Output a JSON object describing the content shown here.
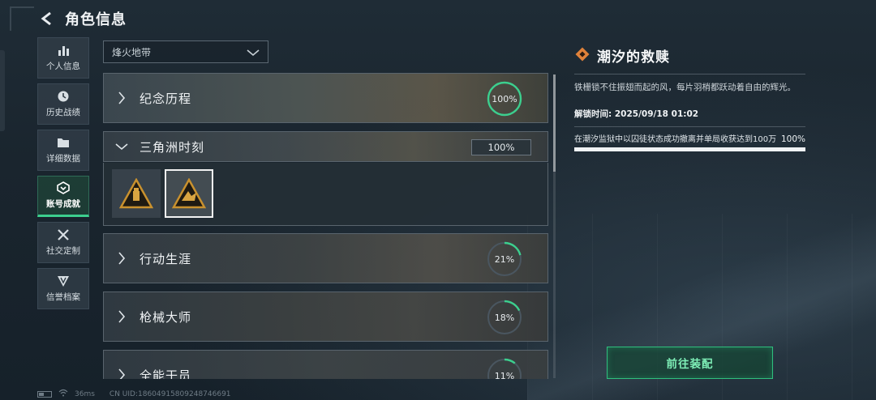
{
  "header": {
    "title": "角色信息",
    "back_icon": "back-arrow-icon"
  },
  "sidebar": {
    "items": [
      {
        "label": "个人信息",
        "icon": "bar-chart-icon",
        "active": false
      },
      {
        "label": "历史战绩",
        "icon": "clock-icon",
        "active": false
      },
      {
        "label": "详细数据",
        "icon": "folder-icon",
        "active": false
      },
      {
        "label": "账号成就",
        "icon": "achievement-icon",
        "active": true
      },
      {
        "label": "社交定制",
        "icon": "tools-icon",
        "active": false
      },
      {
        "label": "信誉档案",
        "icon": "shield-icon",
        "active": false
      }
    ]
  },
  "mode_select": {
    "value": "烽火地带"
  },
  "achievements": [
    {
      "name": "纪念历程",
      "progress": "100%",
      "progress_value": 1.0
    },
    {
      "name": "三角洲时刻",
      "progress": "100%",
      "progress_value": 1.0,
      "expanded": true
    },
    {
      "name": "行动生涯",
      "progress": "21%",
      "progress_value": 0.21
    },
    {
      "name": "枪械大师",
      "progress": "18%",
      "progress_value": 0.18
    },
    {
      "name": "全能干员",
      "progress": "11%",
      "progress_value": 0.11
    }
  ],
  "detail": {
    "title": "潮汐的救赎",
    "description": "铁栅锁不住振翅而起的风，每片羽梢都跃动着自由的辉光。",
    "unlock_label": "解锁时间:",
    "unlock_time": "2025/09/18 01:02",
    "task_text": "在潮汐监狱中以囚徒状态成功撤离并单局收获达到100万",
    "task_pct": "100%",
    "task_progress": 1.0
  },
  "equip_button": {
    "label": "前往装配"
  },
  "footer": {
    "ping": "36ms",
    "uid": "CN UID:18604915809248746691"
  },
  "colors": {
    "accent_green": "#3ccf8e",
    "ring_track": "#4a5660"
  }
}
